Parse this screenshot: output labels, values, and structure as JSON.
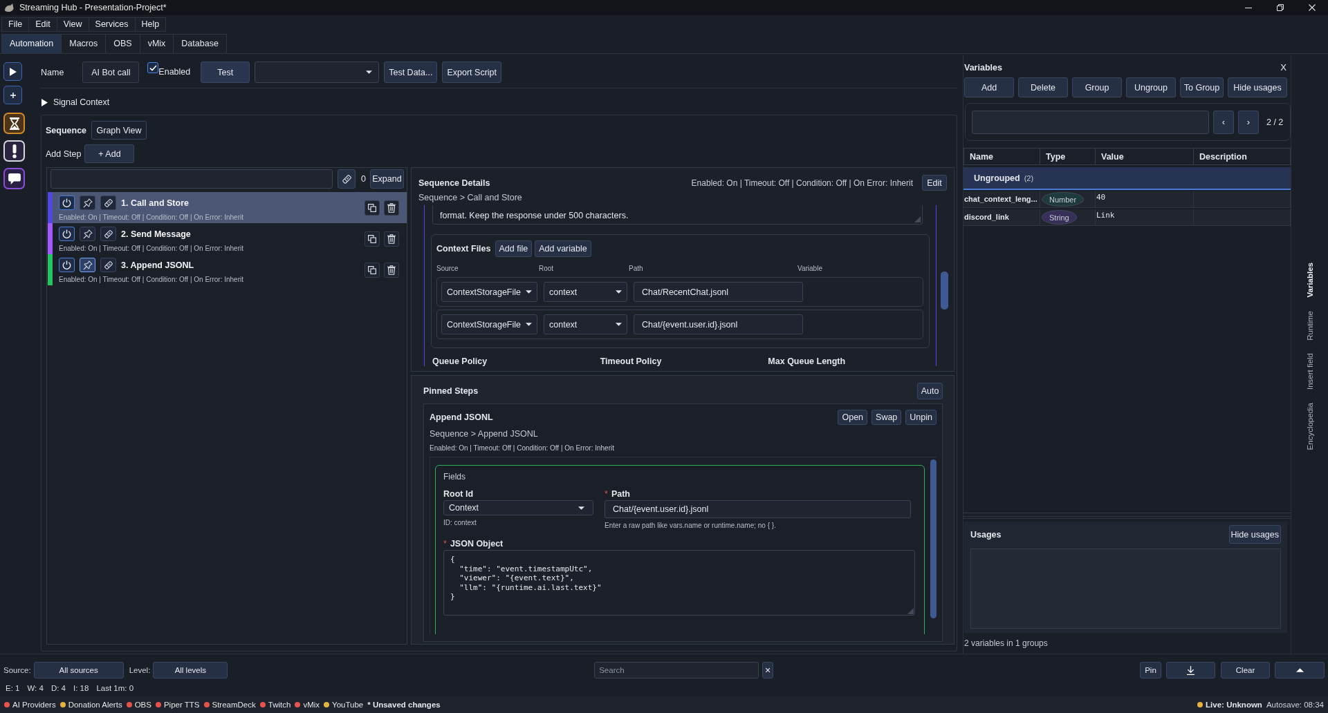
{
  "window": {
    "title": "Streaming Hub - Presentation-Project*"
  },
  "menu": [
    {
      "label": "File"
    },
    {
      "label": "Edit"
    },
    {
      "label": "View"
    },
    {
      "label": "Services"
    },
    {
      "label": "Help"
    }
  ],
  "tabs": [
    {
      "label": "Automation",
      "selected": true
    },
    {
      "label": "Macros",
      "selected": false
    },
    {
      "label": "OBS",
      "selected": false
    },
    {
      "label": "vMix",
      "selected": false
    },
    {
      "label": "Database",
      "selected": false
    }
  ],
  "toolbar": {
    "name": {
      "label": "Name",
      "value": "AI Bot call"
    },
    "enabled": {
      "label": "Enabled",
      "checked": true
    },
    "test_button": "Test",
    "buttons": [
      "Test Data...",
      "Export Script"
    ]
  },
  "signal_context": {
    "label": "Signal Context",
    "expanded": false
  },
  "sequence": {
    "title": "Sequence",
    "graph_view_button": "Graph View",
    "add_step_label": "Add Step",
    "add_button": "+ Add",
    "pinned_count": "0",
    "expand_button": "Expand",
    "steps": [
      {
        "title": "1. Call and Store",
        "summary": "Enabled: On | Timeout: Off | Condition: Off | On Error: Inherit",
        "color": "#4f46e5",
        "selected": true,
        "enabled": true,
        "pinned": false
      },
      {
        "title": "2. Send Message",
        "summary": "Enabled: On | Timeout: Off | Condition: Off | On Error: Inherit",
        "color": "#a259ff",
        "selected": false,
        "enabled": true,
        "pinned": false
      },
      {
        "title": "3. Append JSONL",
        "summary": "Enabled: On | Timeout: Off | Condition: Off | On Error: Inherit",
        "color": "#22c55e",
        "selected": false,
        "enabled": true,
        "pinned": true
      }
    ]
  },
  "sequence_details": {
    "title": "Sequence Details",
    "status": "Enabled: On | Timeout: Off | Condition: Off | On Error: Inherit",
    "edit_button": "Edit",
    "breadcrumb": "Sequence > Call and Store",
    "prompt": "format. Keep the response under 500 characters.",
    "context_files": {
      "title": "Context Files",
      "buttons": [
        "Add file",
        "Add variable"
      ],
      "columns": [
        "Source",
        "Root",
        "Path",
        "Variable"
      ],
      "rows": [
        {
          "source": "ContextStorageFile",
          "root": "context",
          "path": "Chat/RecentChat.jsonl"
        },
        {
          "source": "ContextStorageFile",
          "root": "context",
          "path": "Chat/{event.user.id}.jsonl"
        }
      ]
    },
    "policies": [
      "Queue Policy",
      "Timeout Policy",
      "Max Queue Length"
    ]
  },
  "pinned_steps": {
    "title": "Pinned Steps",
    "auto_button": "Auto",
    "card": {
      "title": "Append JSONL",
      "buttons": [
        "Open",
        "Swap",
        "Unpin"
      ],
      "breadcrumb": "Sequence > Append JSONL",
      "summary": "Enabled: On | Timeout: Off | Condition: Off | On Error: Inherit",
      "fields": {
        "title": "Fields",
        "root_id": {
          "label": "Root Id",
          "value": "Context",
          "note": "ID: context"
        },
        "path": {
          "required_mark": "*",
          "label": "Path",
          "value": "Chat/{event.user.id}.jsonl",
          "hint": "Enter a raw path like vars.name or runtime.name; no { }."
        },
        "json_object": {
          "required_mark": "*",
          "label": "JSON Object",
          "value": "{\n  \"time\": \"event.timestampUtc\",\n  \"viewer\": \"{event.text}\",\n  \"llm\": \"{runtime.ai.last.text}\"\n}"
        }
      }
    }
  },
  "variables": {
    "title": "Variables",
    "close": "X",
    "buttons": [
      "Add",
      "Delete",
      "Group",
      "Ungroup",
      "To Group",
      "Hide usages"
    ],
    "pager": {
      "prev": "‹",
      "next": "›",
      "page": "2 / 2"
    },
    "table": {
      "columns": [
        "Name",
        "Type",
        "Value",
        "Description"
      ],
      "groups": [
        {
          "name": "Ungrouped",
          "count": "(2)",
          "rows": [
            {
              "name": "chat_context_leng...",
              "type": "Number",
              "color": "#1f3a3b",
              "value": "40"
            },
            {
              "name": "discord_link",
              "type": "String",
              "color": "#372e5a",
              "value": "Link"
            }
          ]
        }
      ]
    },
    "usages": {
      "title": "Usages",
      "hide_button": "Hide usages"
    },
    "summary": "2 variables in 1 groups"
  },
  "side_tabs": [
    {
      "label": "Variables",
      "selected": true
    },
    {
      "label": "Runtime",
      "selected": false
    },
    {
      "label": "Insert field",
      "selected": false
    },
    {
      "label": "Encyclopedia",
      "selected": false
    }
  ],
  "log_bar": {
    "source_label": "Source:",
    "source_value": "All sources",
    "level_label": "Level:",
    "level_value": "All levels",
    "search": {
      "placeholder": "Search"
    },
    "clear_search": "×",
    "pin_button": "Pin",
    "clear_button": "Clear"
  },
  "counts": [
    "E: 1",
    "W: 4",
    "D: 4",
    "I: 18",
    "Last 1m: 0"
  ],
  "status_bar": {
    "services": [
      {
        "name": "AI Providers",
        "color": "#e5534b"
      },
      {
        "name": "Donation Alerts",
        "color": "#e3b341"
      },
      {
        "name": "OBS",
        "color": "#e5534b"
      },
      {
        "name": "Piper TTS",
        "color": "#e5534b"
      },
      {
        "name": "StreamDeck",
        "color": "#e5534b"
      },
      {
        "name": "Twitch",
        "color": "#e5534b"
      },
      {
        "name": "vMix",
        "color": "#e5534b"
      },
      {
        "name": "YouTube",
        "color": "#e3b341"
      }
    ],
    "unsaved": "* Unsaved changes",
    "live": {
      "label": "Live: Unknown",
      "color": "#e3b341"
    },
    "autosave": "Autosave: 08:34"
  }
}
